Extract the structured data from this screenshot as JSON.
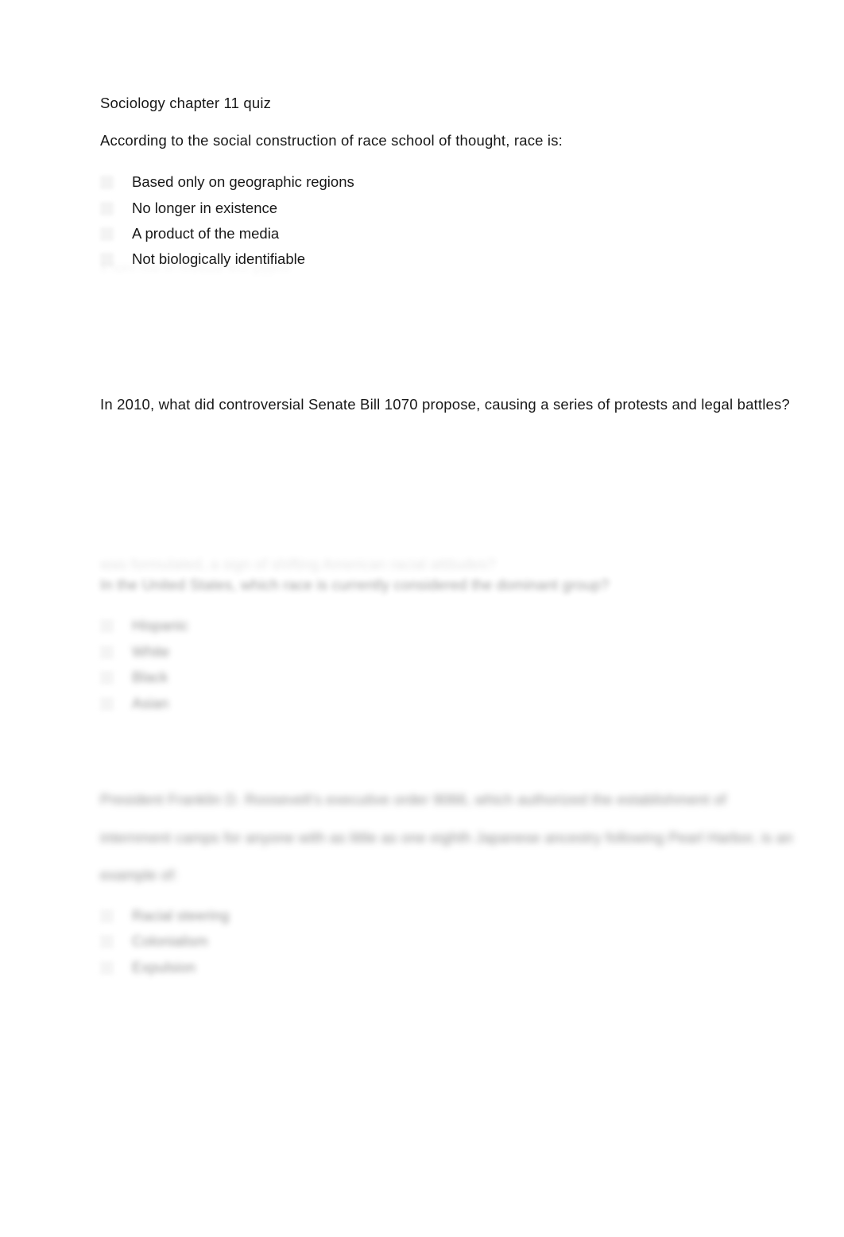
{
  "document": {
    "title": "Sociology chapter 11 quiz",
    "background_color": "#ffffff",
    "text_color": "#181818",
    "marker_color": "#f1f1f1"
  },
  "questions": [
    {
      "id": "q1",
      "prompt": "According to the social construction of race school of thought, race is:",
      "legible": true,
      "options": [
        {
          "label": "Based only on geographic regions",
          "legible": true
        },
        {
          "label": "No longer in existence",
          "legible": true
        },
        {
          "label": "A product of the media",
          "legible": true
        },
        {
          "label": "Not biologically identifiable",
          "legible": true
        }
      ]
    },
    {
      "id": "q2",
      "prompt": "In 2010, what did controversial Senate Bill 1070 propose, causing a series of protests and legal battles?",
      "legible": true,
      "options": []
    },
    {
      "id": "q3",
      "prompt_lines": [
        "was formulated, a sign of shifting American racial attitudes?",
        "In the United States, which race is currently considered the dominant group?"
      ],
      "legible": false,
      "options": [
        {
          "label": "Hispanic",
          "legible": false
        },
        {
          "label": "White",
          "legible": false
        },
        {
          "label": "Black",
          "legible": false
        },
        {
          "label": "Asian",
          "legible": false
        }
      ]
    },
    {
      "id": "q4",
      "prompt_lines": [
        "President Franklin D. Roosevelt's executive order 9066, which authorized the establishment of",
        "internment camps for anyone with as little as one eighth Japanese ancestry following Pearl Harbor, is an",
        "example of:"
      ],
      "legible": false,
      "options": [
        {
          "label": "Racial steering",
          "legible": false
        },
        {
          "label": "Colonialism",
          "legible": false
        },
        {
          "label": "Expulsion",
          "legible": false
        }
      ]
    }
  ],
  "artifacts": {
    "ghost_line_1": "a faint row of residual text glyphs",
    "ghost_line_2": "a faint row of residual text glyphs"
  }
}
